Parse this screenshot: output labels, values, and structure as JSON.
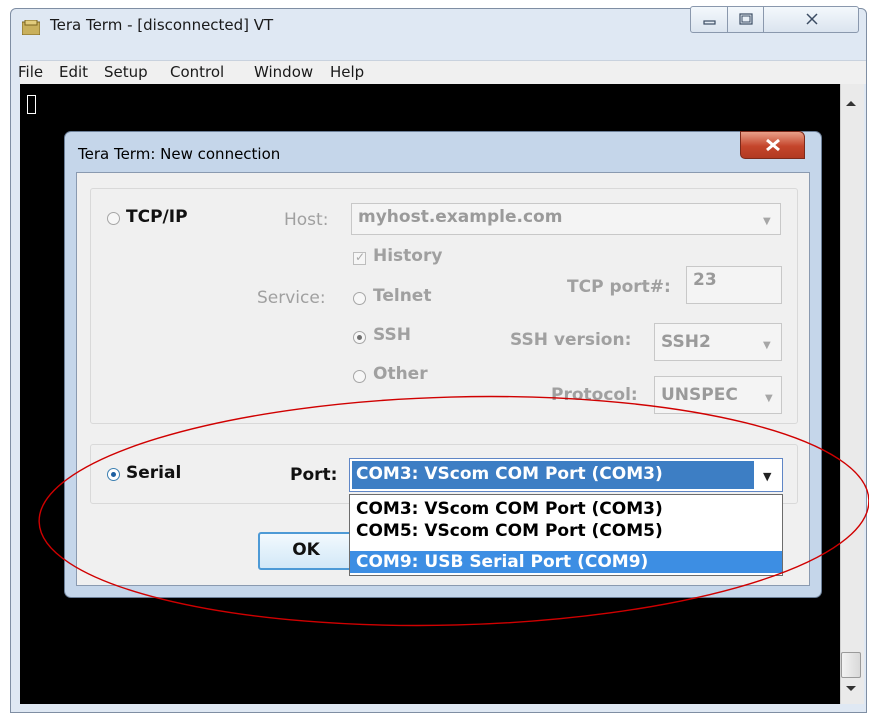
{
  "window": {
    "title": "Tera Term - [disconnected] VT",
    "menu": [
      "File",
      "Edit",
      "Setup",
      "Control",
      "Window",
      "Help"
    ]
  },
  "dialog": {
    "title": "Tera Term: New connection",
    "tcpip": {
      "label": "TCP/IP",
      "host_label": "Host:",
      "host_value": "myhost.example.com",
      "history_label": "History",
      "service_label": "Service:",
      "services": [
        "Telnet",
        "SSH",
        "Other"
      ],
      "service_selected": "SSH",
      "tcp_port_label": "TCP port#:",
      "tcp_port_value": "23",
      "ssh_version_label": "SSH version:",
      "ssh_version_value": "SSH2",
      "protocol_label": "Protocol:",
      "protocol_value": "UNSPEC"
    },
    "serial": {
      "label": "Serial",
      "port_label": "Port:",
      "port_value": "COM3: VScom COM Port (COM3)",
      "port_options": [
        "COM3: VScom COM Port (COM3)",
        "COM5: VScom COM Port (COM5)",
        "COM9: USB Serial Port (COM9)"
      ],
      "highlighted_option": "COM9: USB Serial Port (COM9)"
    },
    "ok_label": "OK"
  },
  "colors": {
    "terminal_bg": "#000000",
    "selection": "#3d8ee3",
    "annotation_ellipse": "#d00000"
  }
}
